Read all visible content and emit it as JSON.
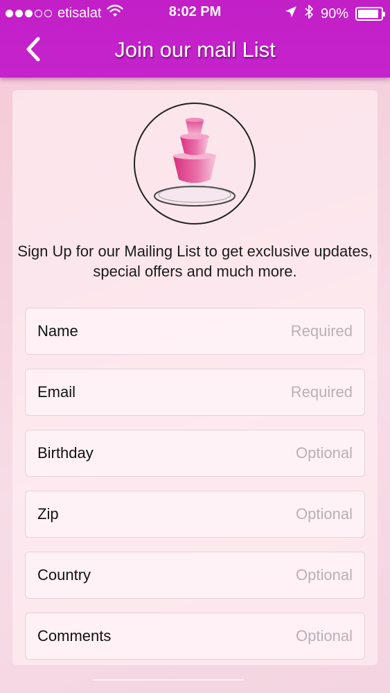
{
  "status_bar": {
    "carrier": "etisalat",
    "time": "8:02 PM",
    "battery": "90%",
    "battery_level": 0.9,
    "signal_bars_filled": 3,
    "signal_bars_total": 5
  },
  "nav": {
    "title": "Join our mail List"
  },
  "intro_text": "Sign Up for our Mailing List to get exclusive updates, special offers and much more.",
  "fields": [
    {
      "label": "Name",
      "placeholder": "Required"
    },
    {
      "label": "Email",
      "placeholder": "Required"
    },
    {
      "label": "Birthday",
      "placeholder": "Optional"
    },
    {
      "label": "Zip",
      "placeholder": "Optional"
    },
    {
      "label": "Country",
      "placeholder": "Optional"
    },
    {
      "label": "Comments",
      "placeholder": "Optional"
    }
  ],
  "colors": {
    "header": "#c523cc",
    "logo_pink": "#e0559a",
    "text": "#111111",
    "placeholder": "#b8b0b6"
  },
  "icons": {
    "back": "chevron-left-icon",
    "wifi": "wifi-icon",
    "location": "location-arrow-icon",
    "bluetooth": "bluetooth-icon",
    "battery": "battery-icon"
  }
}
